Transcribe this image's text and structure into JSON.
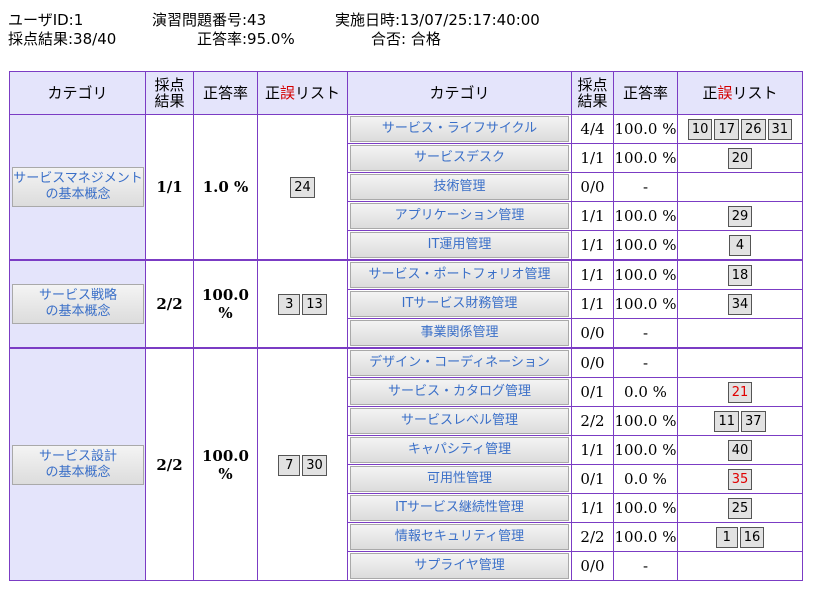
{
  "header": {
    "user_id": "ユーザID:1",
    "exercise_no": "演習問題番号:43",
    "date": "実施日時:13/07/25:17:40:00",
    "score": "採点結果:38/40",
    "accuracy": "正答率:95.0%",
    "pass_result": "合否: 合格"
  },
  "table_headers": {
    "category": "カテゴリ",
    "score": [
      "採点",
      "結果"
    ],
    "rate": "正答率",
    "list_prefix": "正",
    "list_red": "誤",
    "list_suffix": "リスト"
  },
  "groups": [
    {
      "category": [
        "サービスマネジメント",
        "の基本概念"
      ],
      "score": "1/1",
      "rate": "1.0 %",
      "questions": [
        {
          "n": "24",
          "wrong": false
        }
      ],
      "subs": [
        {
          "name": "サービス・ライフサイクル",
          "score": "4/4",
          "rate": "100.0 %",
          "questions": [
            {
              "n": "10",
              "wrong": false
            },
            {
              "n": "17",
              "wrong": false
            },
            {
              "n": "26",
              "wrong": false
            },
            {
              "n": "31",
              "wrong": false
            }
          ]
        },
        {
          "name": "サービスデスク",
          "score": "1/1",
          "rate": "100.0 %",
          "questions": [
            {
              "n": "20",
              "wrong": false
            }
          ]
        },
        {
          "name": "技術管理",
          "score": "0/0",
          "rate": "-",
          "questions": []
        },
        {
          "name": "アプリケーション管理",
          "score": "1/1",
          "rate": "100.0 %",
          "questions": [
            {
              "n": "29",
              "wrong": false
            }
          ]
        },
        {
          "name": "IT運用管理",
          "score": "1/1",
          "rate": "100.0 %",
          "questions": [
            {
              "n": "4",
              "wrong": false
            }
          ]
        }
      ]
    },
    {
      "category": [
        "サービス戦略",
        "の基本概念"
      ],
      "score": "2/2",
      "rate": "100.0 %",
      "questions": [
        {
          "n": "3",
          "wrong": false
        },
        {
          "n": "13",
          "wrong": false
        }
      ],
      "subs": [
        {
          "name": "サービス・ポートフォリオ管理",
          "score": "1/1",
          "rate": "100.0 %",
          "questions": [
            {
              "n": "18",
              "wrong": false
            }
          ]
        },
        {
          "name": "ITサービス財務管理",
          "score": "1/1",
          "rate": "100.0 %",
          "questions": [
            {
              "n": "34",
              "wrong": false
            }
          ]
        },
        {
          "name": "事業関係管理",
          "score": "0/0",
          "rate": "-",
          "questions": []
        }
      ]
    },
    {
      "category": [
        "サービス設計",
        "の基本概念"
      ],
      "score": "2/2",
      "rate": "100.0 %",
      "questions": [
        {
          "n": "7",
          "wrong": false
        },
        {
          "n": "30",
          "wrong": false
        }
      ],
      "subs": [
        {
          "name": "デザイン・コーディネーション",
          "score": "0/0",
          "rate": "-",
          "questions": []
        },
        {
          "name": "サービス・カタログ管理",
          "score": "0/1",
          "rate": "0.0 %",
          "questions": [
            {
              "n": "21",
              "wrong": true
            }
          ]
        },
        {
          "name": "サービスレベル管理",
          "score": "2/2",
          "rate": "100.0 %",
          "questions": [
            {
              "n": "11",
              "wrong": false
            },
            {
              "n": "37",
              "wrong": false
            }
          ]
        },
        {
          "name": "キャパシティ管理",
          "score": "1/1",
          "rate": "100.0 %",
          "questions": [
            {
              "n": "40",
              "wrong": false
            }
          ]
        },
        {
          "name": "可用性管理",
          "score": "0/1",
          "rate": "0.0 %",
          "questions": [
            {
              "n": "35",
              "wrong": true
            }
          ]
        },
        {
          "name": "ITサービス継続性管理",
          "score": "1/1",
          "rate": "100.0 %",
          "questions": [
            {
              "n": "25",
              "wrong": false
            }
          ]
        },
        {
          "name": "情報セキュリティ管理",
          "score": "2/2",
          "rate": "100.0 %",
          "questions": [
            {
              "n": "1",
              "wrong": false
            },
            {
              "n": "16",
              "wrong": false
            }
          ]
        },
        {
          "name": "サプライヤ管理",
          "score": "0/0",
          "rate": "-",
          "questions": []
        }
      ]
    }
  ]
}
